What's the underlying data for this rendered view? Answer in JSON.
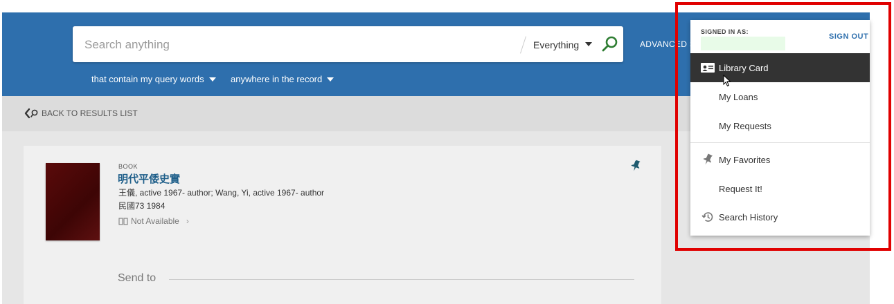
{
  "search": {
    "placeholder": "Search anything",
    "scope": "Everything",
    "advanced_label": "ADVANCED SE"
  },
  "filters": [
    {
      "label": "that contain my query words"
    },
    {
      "label": "anywhere in the record"
    }
  ],
  "back_link": "BACK TO RESULTS LIST",
  "record": {
    "type": "BOOK",
    "title": "明代平倭史實",
    "author": "王儀, active 1967- author; Wang, Yi, active 1967- author",
    "date": "民國73 1984",
    "availability": "Not Available",
    "send_to": "Send to"
  },
  "user_menu": {
    "signed_in_label": "SIGNED IN AS:",
    "sign_out": "SIGN OUT",
    "items": [
      {
        "label": "Library Card",
        "icon": "id-card-icon",
        "active": true
      },
      {
        "label": "My Loans",
        "icon": "",
        "active": false
      },
      {
        "label": "My Requests",
        "icon": "",
        "active": false
      },
      {
        "label": "My Favorites",
        "icon": "pin-icon",
        "active": false
      },
      {
        "label": "Request It!",
        "icon": "",
        "active": false
      },
      {
        "label": "Search History",
        "icon": "history-icon",
        "active": false
      }
    ]
  },
  "colors": {
    "header": "#2e6fad",
    "title": "#1f5f8a",
    "highlight": "#e00000",
    "active_item": "#333333"
  }
}
